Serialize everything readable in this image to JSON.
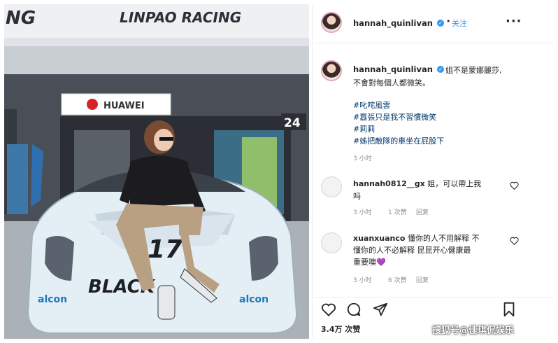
{
  "photo": {
    "top_sign": "LINPAO RACING",
    "top_left_sign": "NG",
    "garage_sign": "HUAWEI",
    "garage_number": "24",
    "car_number": "17",
    "car_brand": "BLACK",
    "sponsor_left": "alcon",
    "sponsor_right": "alcon"
  },
  "header": {
    "username": "hannah_quinlivan",
    "dot": "•",
    "follow_label": "关注",
    "more_label": "···"
  },
  "caption": {
    "username": "hannah_quinlivan",
    "lines": [
      "姐不是蒙娜麗莎,",
      "不會對每個人都微笑。"
    ],
    "hashtags": [
      "#叱咤風雲",
      "#囂張只是我不習慣微笑",
      "#莉莉",
      "#姊把敵隊的車坐在屁股下"
    ],
    "time": "3 小时"
  },
  "comments": [
    {
      "username": "hannah0812__gx",
      "text_line1": " 姐，可以帶上我",
      "text_line2": "吗",
      "time": "3 小时",
      "likes": "1 次赞",
      "reply": "回复"
    },
    {
      "username": "xuanxuanco",
      "text_line1": " 懂你的人不用解释 不",
      "text_line2": "懂你的人不必解释 昆昆开心健康最",
      "text_line3": "重要噢💜",
      "time": "3 小时",
      "likes": "6 次赞",
      "reply": "回复"
    }
  ],
  "footer": {
    "views": "3.4万 次赞"
  },
  "watermark": "搜狐号@佳琪侃娱乐",
  "colors": {
    "link_blue": "#3897f0",
    "hashtag_blue": "#00376b",
    "secondary_gray": "#8e8e8e",
    "verified_blue": "#3897f0",
    "car_body": "#e3eef5"
  },
  "icons": {
    "verified": "verified-badge-icon",
    "heart": "heart-icon",
    "comment": "comment-icon",
    "share": "share-icon",
    "save": "bookmark-icon"
  }
}
